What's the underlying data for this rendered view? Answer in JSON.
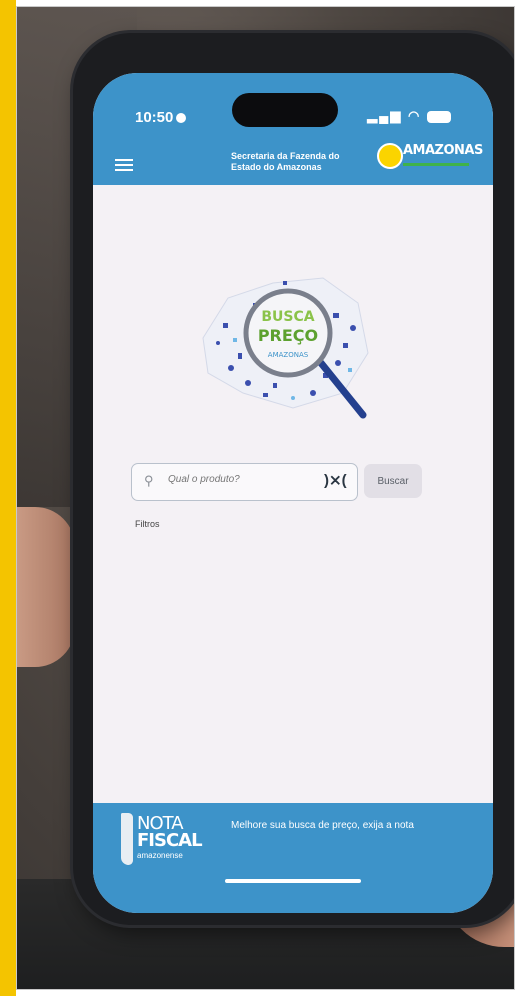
{
  "status_bar": {
    "time": "10:50"
  },
  "header": {
    "agency": "Secretaria da Fazenda do Estado do Amazonas",
    "logo_text": "AMAZONAS"
  },
  "hero": {
    "line1": "BUSCA",
    "line2": "PREÇO",
    "line3": "AMAZONAS"
  },
  "search": {
    "placeholder": "Qual o produto?",
    "button_label": "Buscar",
    "filters_label": "Filtros"
  },
  "footer": {
    "nota_line1": "NOTA",
    "nota_line2": "FISCAL",
    "nota_line3": "amazonense",
    "message": "Melhore sua busca de preço, exija a nota"
  },
  "colors": {
    "header_blue": "#3d93c9",
    "screen_bg": "#f4f1f5",
    "frame_yellow": "#f4c400"
  }
}
